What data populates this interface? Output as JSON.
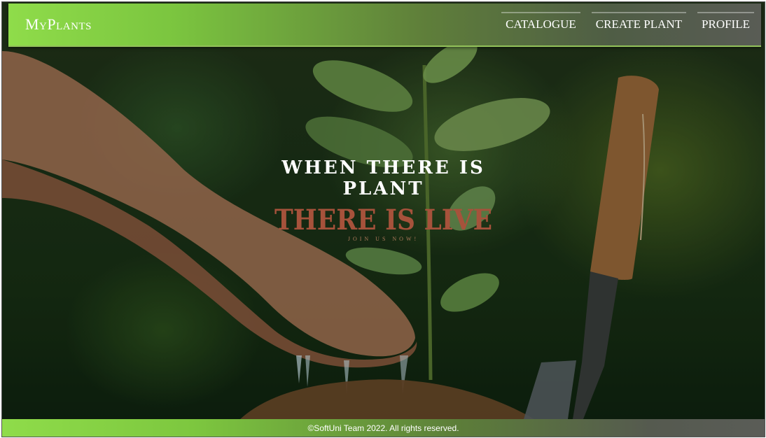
{
  "navbar": {
    "logo": "MyPlants",
    "links": [
      "CATALOGUE",
      "CREATE PLANT",
      "PROFILE"
    ]
  },
  "hero": {
    "headline_line1": "WHEN THERE IS",
    "headline_line2": "PLANT",
    "subheadline": "THERE IS LIVE",
    "cta": "JOIN US NOW!"
  },
  "footer": {
    "text": "©SoftUni Team 2022. All rights reserved."
  },
  "colors": {
    "nav_green": "#8fdc4a",
    "nav_gray": "#595c55",
    "subheadline": "#a6523b"
  }
}
